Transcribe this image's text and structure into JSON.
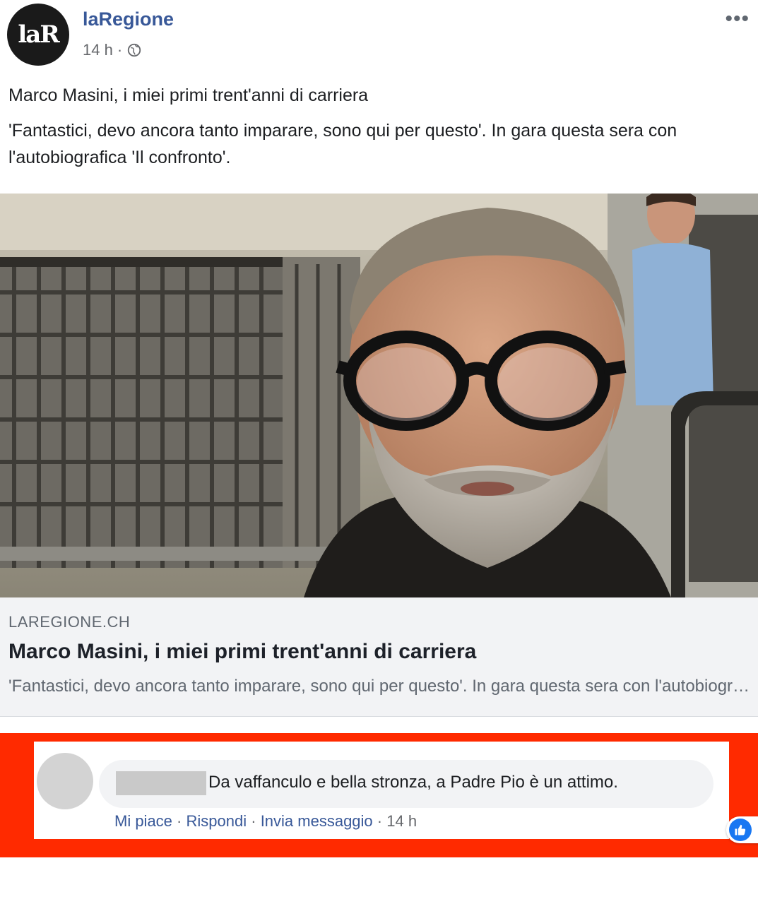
{
  "post": {
    "avatar_text": "laR",
    "page_name": "laRegione",
    "time": "14 h",
    "dot": "·",
    "more": "•••",
    "headline": "Marco Masini, i miei primi trent'anni di carriera",
    "body": "'Fantastici, devo ancora tanto imparare, sono qui per questo'. In gara questa sera con l'autobiografica 'Il confronto'."
  },
  "link_preview": {
    "domain": "LAREGIONE.CH",
    "title": "Marco Masini, i miei primi trent'anni di carriera",
    "description": "'Fantastici, devo ancora tanto imparare, sono qui per questo'. In gara questa sera con l'autobiografica 'Il confronto'."
  },
  "comment": {
    "text": "Da vaffanculo e bella stronza, a Padre Pio è un attimo.",
    "reaction_count": "1",
    "actions": {
      "like": "Mi piace",
      "reply": "Rispondi",
      "message": "Invia messaggio",
      "sep": "·",
      "time": "14 h"
    }
  },
  "colors": {
    "link_blue": "#385898",
    "highlight_red": "#ff2a00",
    "like_blue": "#1877f2"
  }
}
